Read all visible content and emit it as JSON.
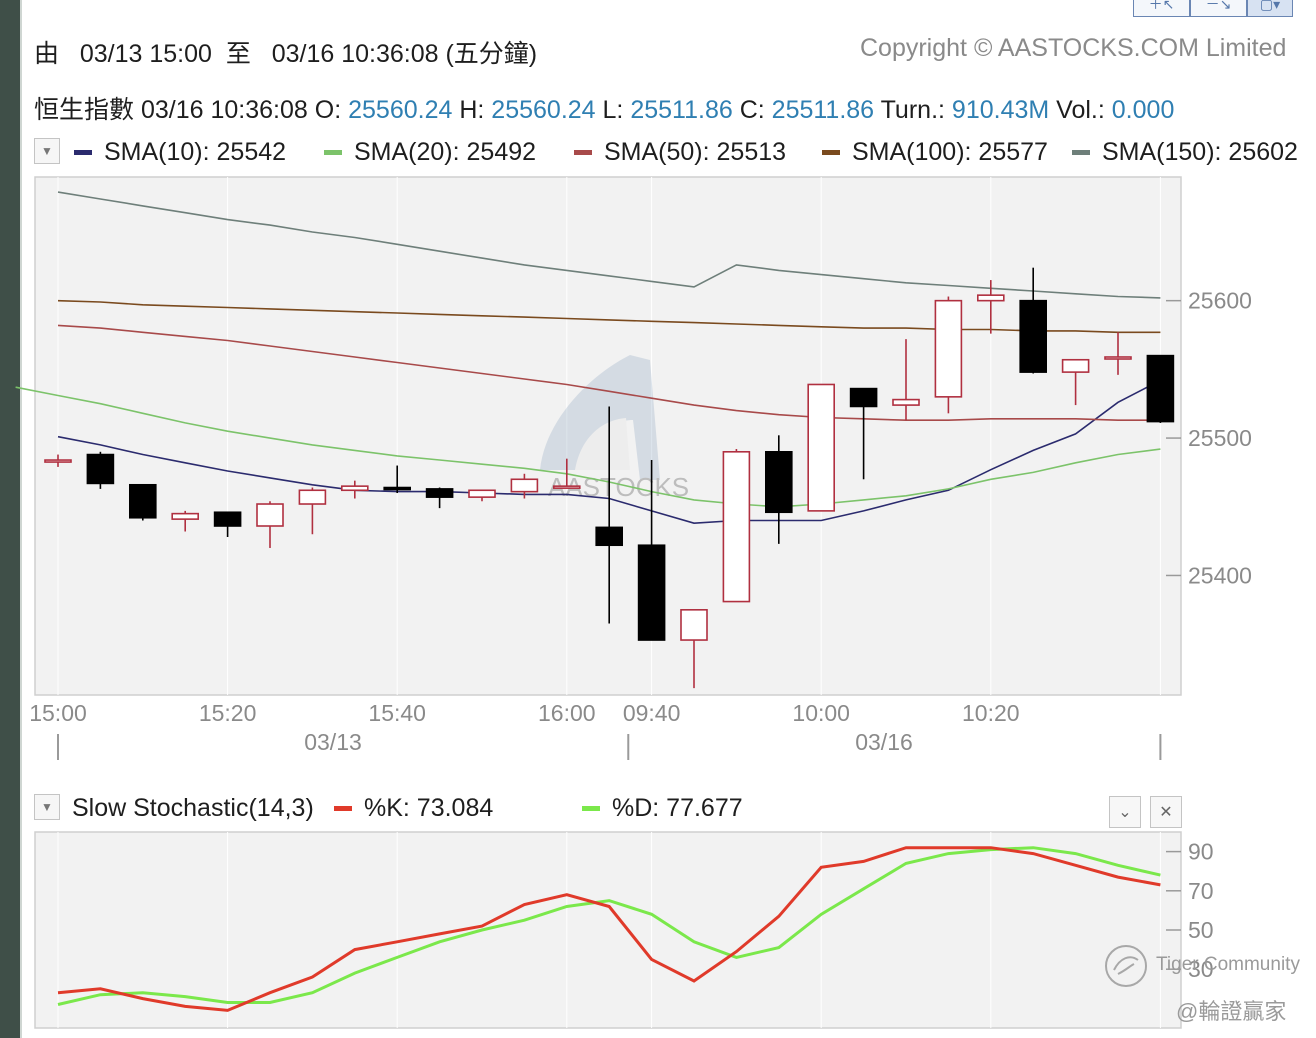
{
  "header": {
    "range_prefix": "由",
    "range_from": "03/13 15:00",
    "range_mid": "至",
    "range_to": "03/16 10:36:08 (五分鐘)",
    "copyright": "Copyright © AASTOCKS.COM Limited"
  },
  "quote": {
    "name": "恒生指數",
    "time": "03/16 10:36:08",
    "open_label": "O:",
    "open": "25560.24",
    "high_label": "H:",
    "high": "25560.24",
    "low_label": "L:",
    "low": "25511.86",
    "close_label": "C:",
    "close": "25511.86",
    "turn_label": "Turn.:",
    "turn": "910.43M",
    "vol_label": "Vol.:",
    "vol": "0.000"
  },
  "colors": {
    "up_candle": "#b03040",
    "down_candle": "#000000",
    "sma10": "#2b2b6e",
    "sma20": "#7cc36a",
    "sma50": "#a84a4a",
    "sma100": "#7a4a1e",
    "sma150": "#6e7f7a",
    "k_line": "#e03a2a",
    "d_line": "#7be84b",
    "value_text": "#2f7fb2"
  },
  "icons": [
    "dropdown-arrow-icon",
    "collapse-chevron-icon",
    "close-x-icon",
    "zoom-in-icon",
    "zoom-out-icon",
    "snapshot-icon",
    "watermark-logo-icon"
  ],
  "sma_legend": [
    {
      "label": "SMA(10): 25542",
      "color": "#2b2b6e"
    },
    {
      "label": "SMA(20): 25492",
      "color": "#7cc36a"
    },
    {
      "label": "SMA(50): 25513",
      "color": "#a84a4a"
    },
    {
      "label": "SMA(100): 25577",
      "color": "#7a4a1e"
    },
    {
      "label": "SMA(150): 25602",
      "color": "#6e7f7a"
    }
  ],
  "stoch_legend": {
    "title": "Slow Stochastic(14,3)",
    "k_label": "%K: 73.084",
    "d_label": "%D: 77.677"
  },
  "watermark": {
    "line1": "Tiger Community",
    "line2": "@輪證贏家"
  },
  "chart_data": [
    {
      "type": "candlestick",
      "title": "恒生指數",
      "x": [
        "15:00",
        "15:05",
        "15:10",
        "15:15",
        "15:20",
        "15:25",
        "15:30",
        "15:35",
        "15:40",
        "15:45",
        "15:50",
        "15:55",
        "16:00",
        "09:35",
        "09:40",
        "09:45",
        "09:50",
        "09:55",
        "10:00",
        "10:05",
        "10:10",
        "10:15",
        "10:20",
        "10:25",
        "10:30",
        "10:35"
      ],
      "x_tick_labels": [
        "15:00",
        "15:20",
        "15:40",
        "16:00",
        "09:40",
        "10:00",
        "10:20"
      ],
      "date_labels": [
        "03/13",
        "03/16"
      ],
      "y_ticks": [
        25400,
        25500,
        25600
      ],
      "ylim": [
        25313,
        25690
      ],
      "candles": [
        {
          "o": 25484,
          "h": 25488,
          "l": 25479,
          "c": 25484
        },
        {
          "o": 25488,
          "h": 25490,
          "l": 25463,
          "c": 25467
        },
        {
          "o": 25466,
          "h": 25466,
          "l": 25440,
          "c": 25442
        },
        {
          "o": 25441,
          "h": 25447,
          "l": 25432,
          "c": 25445
        },
        {
          "o": 25446,
          "h": 25446,
          "l": 25428,
          "c": 25436
        },
        {
          "o": 25436,
          "h": 25454,
          "l": 25420,
          "c": 25452
        },
        {
          "o": 25452,
          "h": 25464,
          "l": 25430,
          "c": 25462
        },
        {
          "o": 25462,
          "h": 25469,
          "l": 25456,
          "c": 25465
        },
        {
          "o": 25464,
          "h": 25480,
          "l": 25460,
          "c": 25463
        },
        {
          "o": 25463,
          "h": 25464,
          "l": 25449,
          "c": 25457
        },
        {
          "o": 25457,
          "h": 25462,
          "l": 25454,
          "c": 25462
        },
        {
          "o": 25461,
          "h": 25474,
          "l": 25456,
          "c": 25470
        },
        {
          "o": 25465,
          "h": 25485,
          "l": 25465,
          "c": 25465
        },
        {
          "o": 25435,
          "h": 25523,
          "l": 25365,
          "c": 25422
        },
        {
          "o": 25422,
          "h": 25484,
          "l": 25353,
          "c": 25353
        },
        {
          "o": 25353,
          "h": 25375,
          "l": 25318,
          "c": 25375
        },
        {
          "o": 25381,
          "h": 25492,
          "l": 25381,
          "c": 25490
        },
        {
          "o": 25490,
          "h": 25502,
          "l": 25423,
          "c": 25446
        },
        {
          "o": 25447,
          "h": 25539,
          "l": 25447,
          "c": 25539
        },
        {
          "o": 25536,
          "h": 25536,
          "l": 25470,
          "c": 25523
        },
        {
          "o": 25524,
          "h": 25572,
          "l": 25513,
          "c": 25528
        },
        {
          "o": 25530,
          "h": 25603,
          "l": 25518,
          "c": 25600
        },
        {
          "o": 25600,
          "h": 25615,
          "l": 25576,
          "c": 25604
        },
        {
          "o": 25600,
          "h": 25624,
          "l": 25547,
          "c": 25548
        },
        {
          "o": 25548,
          "h": 25554,
          "l": 25524,
          "c": 25557
        },
        {
          "o": 25559,
          "h": 25577,
          "l": 25546,
          "c": 25559
        },
        {
          "o": 25560,
          "h": 25560,
          "l": 25511,
          "c": 25512
        }
      ],
      "series": [
        {
          "name": "SMA(10)",
          "values": [
            25501,
            25495,
            25488,
            25482,
            25476,
            25471,
            25466,
            25462,
            25461,
            25461,
            25460,
            25459,
            25459,
            25456,
            25447,
            25438,
            25440,
            25440,
            25440,
            25447,
            25455,
            25462,
            25477,
            25491,
            25503,
            25526,
            25542
          ]
        },
        {
          "name": "SMA(20)",
          "values": [
            25537,
            25531,
            25525,
            25518,
            25511,
            25505,
            25500,
            25495,
            25491,
            25487,
            25484,
            25481,
            25478,
            25474,
            25468,
            25461,
            25455,
            25452,
            25450,
            25452,
            25455,
            25458,
            25463,
            25470,
            25475,
            25482,
            25488,
            25492
          ]
        },
        {
          "name": "SMA(50)",
          "values": [
            25582,
            25580,
            25577,
            25574,
            25571,
            25567,
            25563,
            25559,
            25555,
            25551,
            25547,
            25543,
            25539,
            25534,
            25529,
            25524,
            25520,
            25517,
            25515,
            25514,
            25513,
            25513,
            25514,
            25514,
            25514,
            25513,
            25513
          ]
        },
        {
          "name": "SMA(100)",
          "values": [
            25600,
            25599,
            25597,
            25596,
            25595,
            25594,
            25593,
            25592,
            25591,
            25590,
            25589,
            25588,
            25587,
            25586,
            25585,
            25584,
            25583,
            25582,
            25581,
            25580,
            25580,
            25579,
            25579,
            25578,
            25578,
            25577,
            25577
          ]
        },
        {
          "name": "SMA(150)",
          "values": [
            25679,
            25674,
            25669,
            25664,
            25659,
            25655,
            25650,
            25646,
            25641,
            25636,
            25631,
            25626,
            25622,
            25618,
            25614,
            25610,
            25626,
            25622,
            25619,
            25616,
            25613,
            25611,
            25609,
            25607,
            25605,
            25603,
            25602
          ]
        }
      ]
    },
    {
      "type": "line",
      "title": "Slow Stochastic(14,3)",
      "y_ticks": [
        30,
        50,
        70,
        90
      ],
      "ylim": [
        0,
        100
      ],
      "series": [
        {
          "name": "%K",
          "values": [
            18,
            20,
            15,
            11,
            9,
            18,
            26,
            40,
            44,
            48,
            52,
            63,
            68,
            62,
            35,
            24,
            39,
            57,
            82,
            85,
            92,
            92,
            92,
            89,
            83,
            77,
            73
          ]
        },
        {
          "name": "%D",
          "values": [
            12,
            17,
            18,
            16,
            13,
            13,
            18,
            28,
            36,
            44,
            50,
            55,
            62,
            65,
            58,
            44,
            36,
            41,
            58,
            71,
            84,
            89,
            91,
            92,
            89,
            83,
            78
          ]
        }
      ]
    }
  ]
}
